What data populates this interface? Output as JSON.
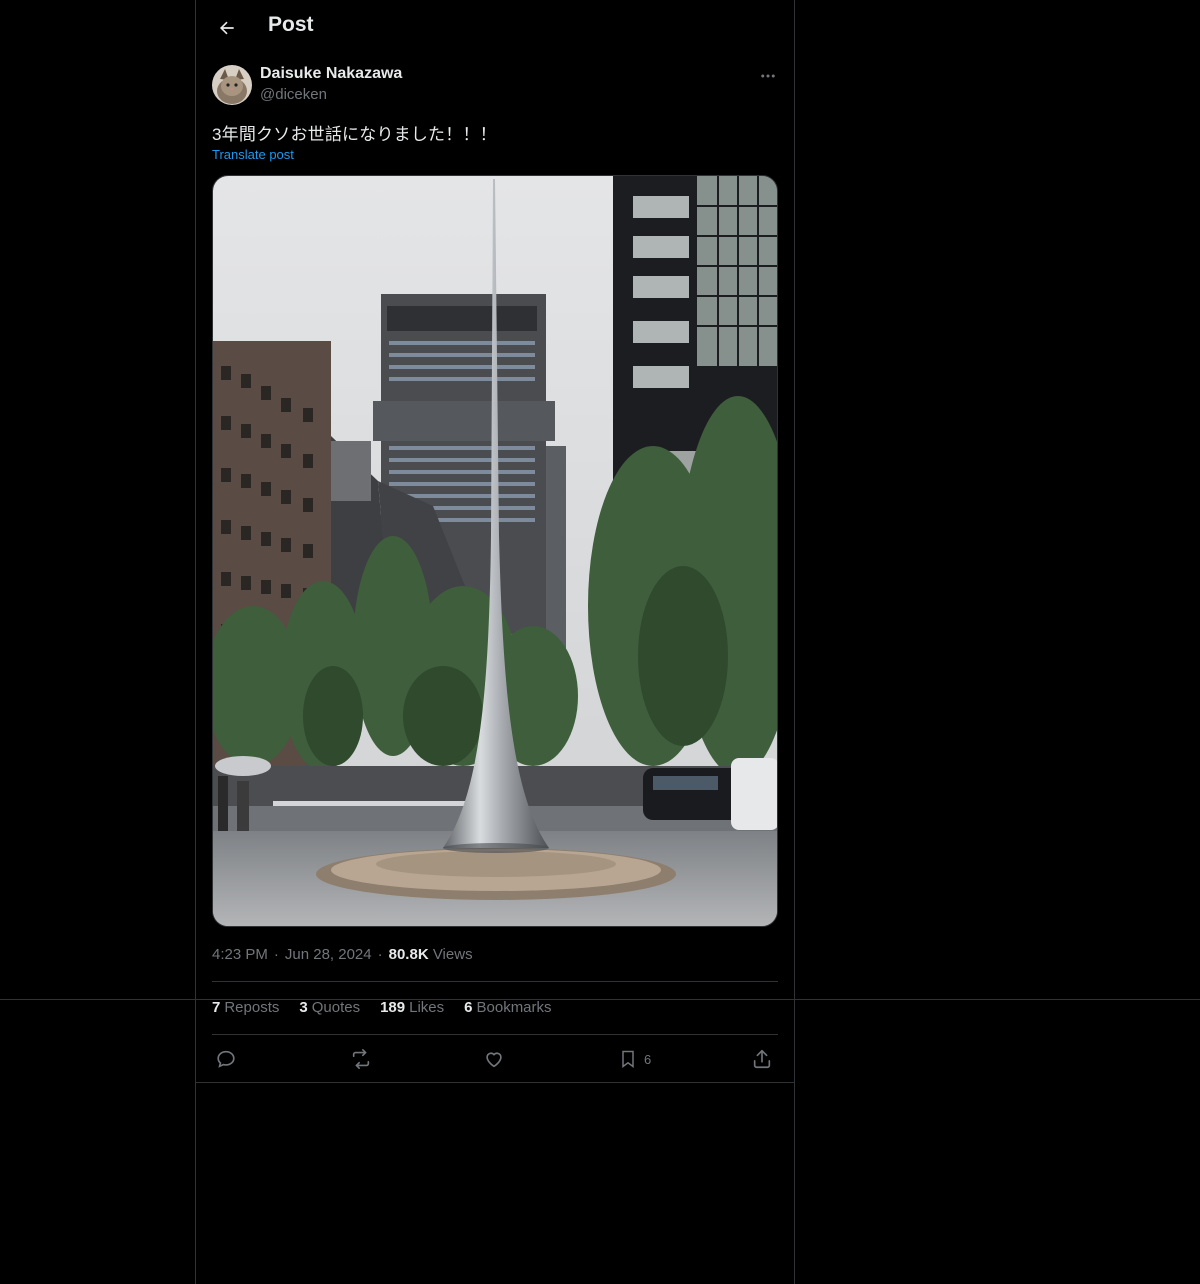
{
  "header": {
    "title": "Post"
  },
  "post": {
    "author": {
      "name": "Daisuke Nakazawa",
      "handle": "@diceken"
    },
    "text": "3年間クソお世話になりました！！！",
    "translate_label": "Translate post",
    "time": "4:23 PM",
    "date": "Jun 28, 2024",
    "views_count": "80.8K",
    "views_label": "Views"
  },
  "stats": {
    "reposts_count": "7",
    "reposts_label": "Reposts",
    "quotes_count": "3",
    "quotes_label": "Quotes",
    "likes_count": "189",
    "likes_label": "Likes",
    "bookmarks_count": "6",
    "bookmarks_label": "Bookmarks"
  },
  "actions": {
    "bookmark_count": "6"
  },
  "icons": [
    "back-arrow-icon",
    "more-icon",
    "reply-icon",
    "repost-icon",
    "like-icon",
    "bookmark-icon",
    "share-icon"
  ],
  "colors": {
    "background": "#000000",
    "text": "#e7e9ea",
    "muted": "#71767b",
    "link": "#1d9bf0",
    "border": "#2f3336"
  }
}
